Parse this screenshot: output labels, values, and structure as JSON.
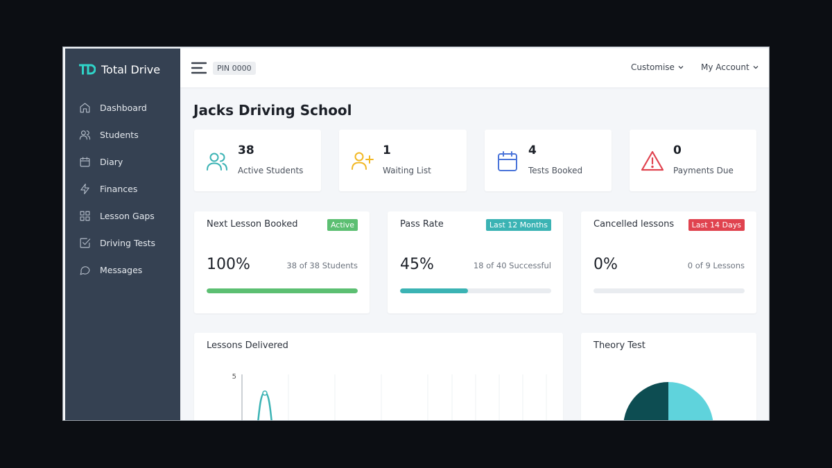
{
  "app": {
    "name": "Total Drive",
    "logo_text": "TD"
  },
  "sidebar": {
    "items": [
      {
        "label": "Dashboard",
        "icon": "home-icon"
      },
      {
        "label": "Students",
        "icon": "users-icon"
      },
      {
        "label": "Diary",
        "icon": "calendar-icon"
      },
      {
        "label": "Finances",
        "icon": "lightning-icon"
      },
      {
        "label": "Lesson Gaps",
        "icon": "grid-icon"
      },
      {
        "label": "Driving Tests",
        "icon": "checkbox-icon"
      },
      {
        "label": "Messages",
        "icon": "chat-icon"
      }
    ]
  },
  "topbar": {
    "pin": "PIN 0000",
    "customise": "Customise",
    "account": "My Account"
  },
  "page": {
    "title": "Jacks Driving School"
  },
  "stats": [
    {
      "value": "38",
      "label": "Active Students",
      "icon": "users-icon",
      "color": "#3bb3b4"
    },
    {
      "value": "1",
      "label": "Waiting List",
      "icon": "user-plus-icon",
      "color": "#f2b824"
    },
    {
      "value": "4",
      "label": "Tests Booked",
      "icon": "calendar-icon",
      "color": "#4a74d9"
    },
    {
      "value": "0",
      "label": "Payments Due",
      "icon": "alert-triangle-icon",
      "color": "#e0434f"
    }
  ],
  "metrics": [
    {
      "title": "Next Lesson Booked",
      "badge": "Active",
      "badge_color": "#5cbf72",
      "value": "100%",
      "sub": "38 of 38 Students",
      "progress": 1.0,
      "bar_color": "#5cbf72"
    },
    {
      "title": "Pass Rate",
      "badge": "Last 12 Months",
      "badge_color": "#3bb3b4",
      "value": "45%",
      "sub": "18 of 40 Successful",
      "progress": 0.45,
      "bar_color": "#3bb3b4"
    },
    {
      "title": "Cancelled lessons",
      "badge": "Last 14 Days",
      "badge_color": "#e0434f",
      "value": "0%",
      "sub": "0 of 9 Lessons",
      "progress": 0.0,
      "bar_color": "#e0434f"
    }
  ],
  "lessons_panel": {
    "title": "Lessons Delivered",
    "y_tick": "5"
  },
  "theory_panel": {
    "title": "Theory Test"
  },
  "colors": {
    "sidebar": "#354152",
    "accent": "#3bb3b4",
    "pie_dark": "#0d4d52",
    "pie_light": "#5fd3dc"
  }
}
